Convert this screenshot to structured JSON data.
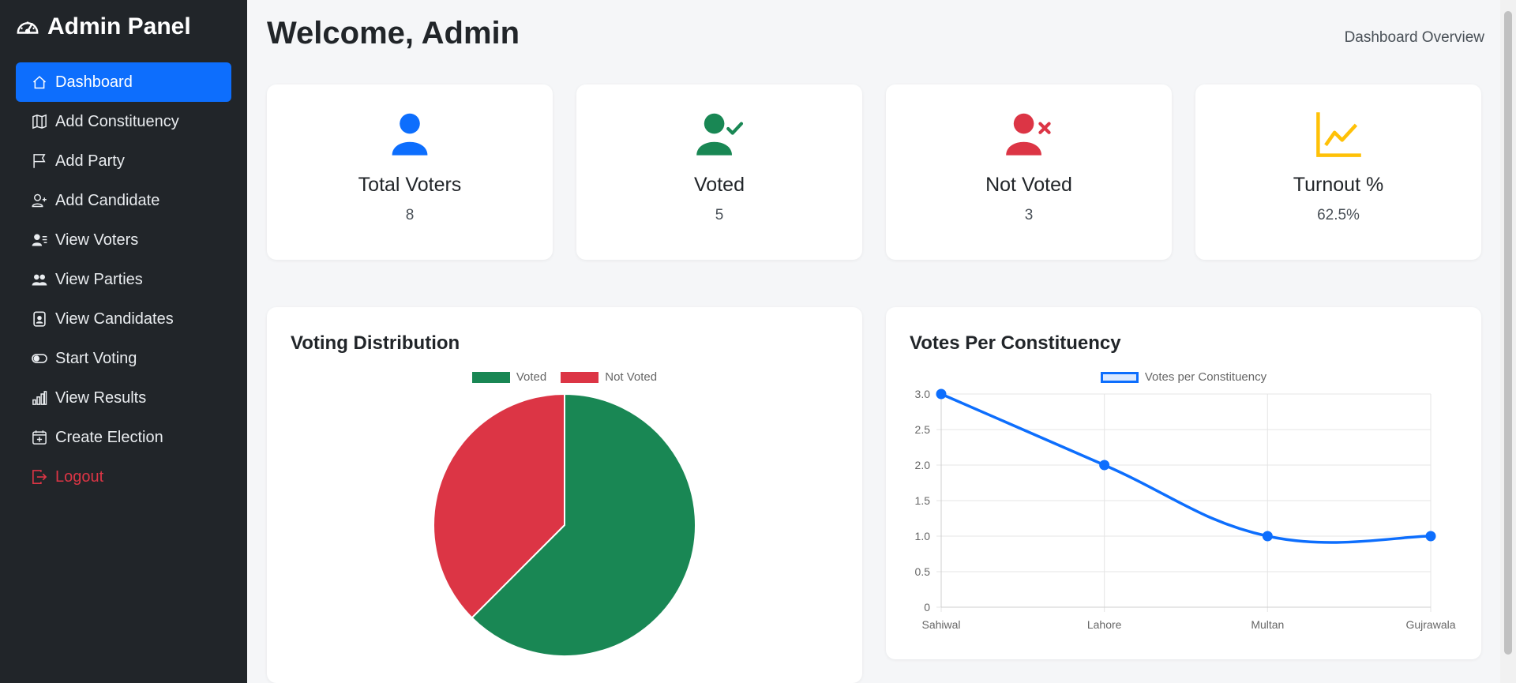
{
  "sidebar": {
    "brand": "Admin Panel",
    "items": [
      {
        "label": "Dashboard",
        "icon": "home-icon"
      },
      {
        "label": "Add Constituency",
        "icon": "map-icon"
      },
      {
        "label": "Add Party",
        "icon": "flag-icon"
      },
      {
        "label": "Add Candidate",
        "icon": "person-add-icon"
      },
      {
        "label": "View Voters",
        "icon": "person-lines-icon"
      },
      {
        "label": "View Parties",
        "icon": "people-icon"
      },
      {
        "label": "View Candidates",
        "icon": "person-badge-icon"
      },
      {
        "label": "Start Voting",
        "icon": "toggle-icon"
      },
      {
        "label": "View Results",
        "icon": "bar-chart-icon"
      },
      {
        "label": "Create Election",
        "icon": "calendar-plus-icon"
      },
      {
        "label": "Logout",
        "icon": "logout-icon"
      }
    ]
  },
  "header": {
    "title": "Welcome, Admin",
    "subtitle": "Dashboard Overview"
  },
  "stats": [
    {
      "label": "Total Voters",
      "value": "8",
      "icon": "person-icon",
      "color": "#0d6efd"
    },
    {
      "label": "Voted",
      "value": "5",
      "icon": "person-check-icon",
      "color": "#198754"
    },
    {
      "label": "Not Voted",
      "value": "3",
      "icon": "person-x-icon",
      "color": "#dc3545"
    },
    {
      "label": "Turnout %",
      "value": "62.5%",
      "icon": "graph-up-icon",
      "color": "#ffc107"
    }
  ],
  "colors": {
    "sidebar_bg": "#212529",
    "accent": "#0d6efd",
    "voted": "#198754",
    "not_voted": "#dc3545",
    "turnout": "#ffc107"
  },
  "chart_data": [
    {
      "type": "pie",
      "title": "Voting Distribution",
      "categories": [
        "Voted",
        "Not Voted"
      ],
      "values": [
        5,
        3
      ],
      "colors": [
        "#198754",
        "#dc3545"
      ],
      "legend": "top"
    },
    {
      "type": "line",
      "title": "Votes Per Constituency",
      "categories": [
        "Sahiwal",
        "Lahore",
        "Multan",
        "Gujrawala"
      ],
      "series": [
        {
          "name": "Votes per Constituency",
          "values": [
            3,
            2,
            1,
            1
          ]
        }
      ],
      "ylim": [
        0,
        3
      ],
      "yticks": [
        "0",
        "0.5",
        "1.0",
        "1.5",
        "2.0",
        "2.5",
        "3.0"
      ],
      "grid": true,
      "legend": "top",
      "color": "#0d6efd"
    }
  ]
}
